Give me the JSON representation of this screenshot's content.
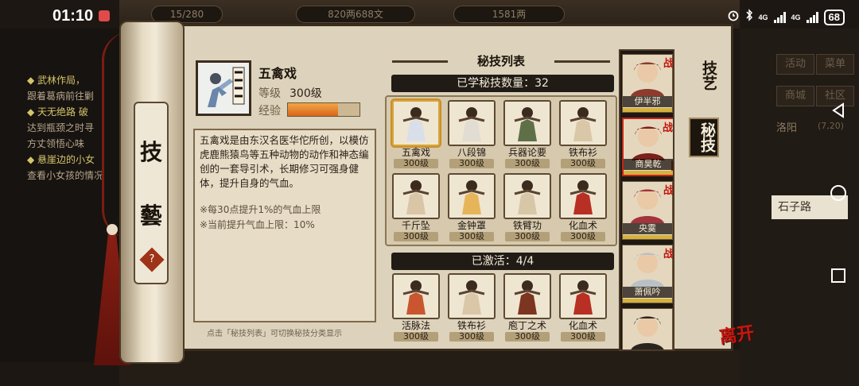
{
  "status_bar": {
    "time": "01:10",
    "network_1": "4G",
    "network_2": "4G",
    "battery": "68"
  },
  "background": {
    "coins": "820两688文",
    "silver": "1581两",
    "stamina": "15/280",
    "log_lines": [
      {
        "text": "◆ 武林作局，",
        "highlight": true
      },
      {
        "text": "跟着葛病前往剿",
        "highlight": false
      },
      {
        "text": "◆ 天无绝路 破",
        "highlight": true
      },
      {
        "text": "达到瓶颈之时寻",
        "highlight": false
      },
      {
        "text": "方丈领悟心味",
        "highlight": false
      },
      {
        "text": "◆ 悬崖边的小女",
        "highlight": true
      },
      {
        "text": "查看小女孩的情况",
        "highlight": false
      }
    ],
    "right_buttons": [
      "活动",
      "菜单",
      "商城",
      "社区"
    ],
    "location": "洛阳",
    "location_coords": "(7,20)",
    "road": "石子路"
  },
  "scroll": {
    "roller_char_1": "技",
    "roller_char_2": "藝",
    "help": "?"
  },
  "detail": {
    "name": "五禽戏",
    "level_label": "等级",
    "level_value": "300级",
    "exp_label": "经验",
    "exp_fraction": 0.7,
    "description": "五禽戏是由东汉名医华佗所创，以模仿虎鹿熊猿鸟等五种动物的动作和神态编创的一套导引术，长期修习可强身健体，提升自身的气血。",
    "note_1": "※每30点提升1%的气血上限",
    "note_2": "※当前提升气血上限：10%",
    "hint": "点击「秘技列表」可切换秘技分类显示"
  },
  "list": {
    "title": "秘技列表",
    "learned_label": "已学秘技数量：32",
    "active_label": "已激活：4/4",
    "learned": [
      {
        "name": "五禽戏",
        "level": "300级",
        "icon": "wuqinxi-icon",
        "tint": "#d9dfe8"
      },
      {
        "name": "八段锦",
        "level": "300级",
        "icon": "baduanjin-icon",
        "tint": "#e2ddd2"
      },
      {
        "name": "兵器论要",
        "level": "300级",
        "icon": "book-icon",
        "tint": "#5f7049"
      },
      {
        "name": "铁布衫",
        "level": "300级",
        "icon": "tiebushan-icon",
        "tint": "#d9c7a7"
      },
      {
        "name": "千斤坠",
        "level": "300级",
        "icon": "qianjinzhui-icon",
        "tint": "#d8c6a6"
      },
      {
        "name": "金钟罩",
        "level": "300级",
        "icon": "golden-bell-icon",
        "tint": "#e6b55a"
      },
      {
        "name": "铁臂功",
        "level": "300级",
        "icon": "iron-arm-icon",
        "tint": "#d7c7a7"
      },
      {
        "name": "化血术",
        "level": "300级",
        "icon": "huaxue-icon",
        "tint": "#b82f24"
      }
    ],
    "active": [
      {
        "name": "活脉法",
        "level": "300级",
        "icon": "huomai-icon",
        "tint": "#c9562f"
      },
      {
        "name": "铁布衫",
        "level": "300级",
        "icon": "tiebushan-icon",
        "tint": "#d9c7a7"
      },
      {
        "name": "庖丁之术",
        "level": "300级",
        "icon": "cleaver-book-icon",
        "tint": "#7c3520"
      },
      {
        "name": "化血术",
        "level": "300级",
        "icon": "huaxue-icon",
        "tint": "#b82f24"
      }
    ]
  },
  "tabs": {
    "skills": "技艺",
    "secret": "秘技"
  },
  "characters": [
    {
      "name": "伊半邪",
      "badge": "战",
      "color": "#8c3b2e"
    },
    {
      "name": "商昊乾",
      "badge": "战",
      "color": "#7d1f1a"
    },
    {
      "name": "央霙",
      "badge": "战",
      "color": "#a3343c"
    },
    {
      "name": "萧佩吟",
      "badge": "战",
      "color": "#b8c1c6"
    },
    {
      "name": "",
      "badge": "",
      "color": "#2a241e"
    }
  ],
  "leave_button": "离开"
}
